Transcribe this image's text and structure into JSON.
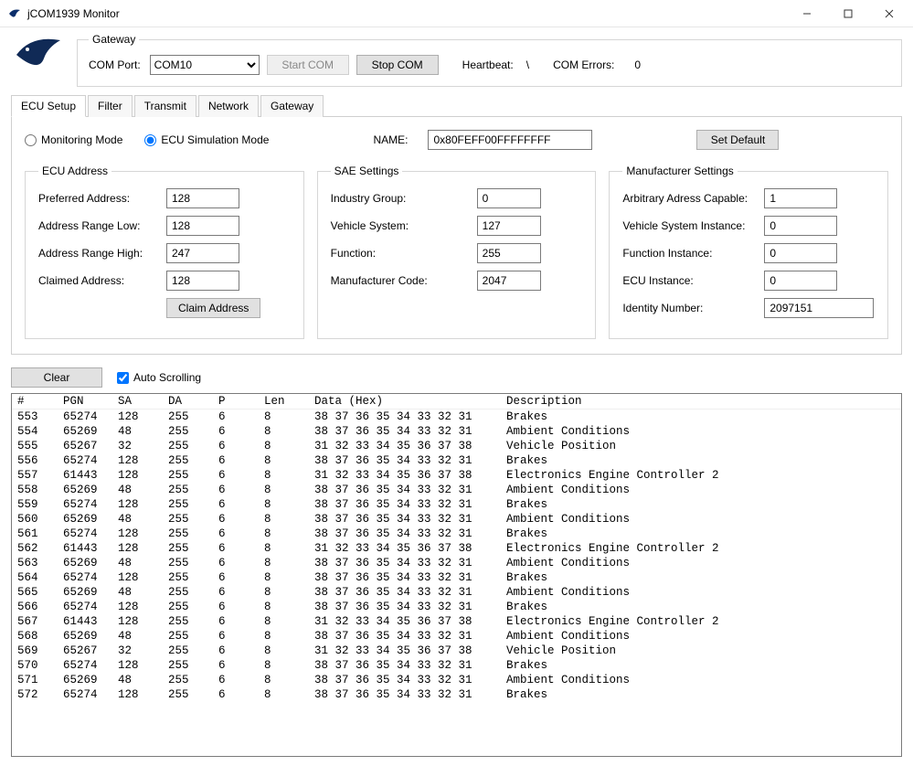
{
  "window": {
    "title": "jCOM1939 Monitor"
  },
  "gateway": {
    "legend": "Gateway",
    "comport_label": "COM Port:",
    "comport_value": "COM10",
    "start_label": "Start COM",
    "stop_label": "Stop COM",
    "heartbeat_label": "Heartbeat:",
    "heartbeat_value": "\\",
    "comerrors_label": "COM Errors:",
    "comerrors_value": "0"
  },
  "tabs": {
    "ecu": "ECU Setup",
    "filter": "Filter",
    "transmit": "Transmit",
    "network": "Network",
    "gateway": "Gateway"
  },
  "mode": {
    "monitoring": "Monitoring Mode",
    "simulation": "ECU Simulation Mode",
    "selected": "simulation"
  },
  "name": {
    "label": "NAME:",
    "value": "0x80FEFF00FFFFFFFF"
  },
  "set_default_label": "Set Default",
  "ecu_addr": {
    "legend": "ECU Address",
    "preferred_label": "Preferred Address:",
    "preferred": "128",
    "low_label": "Address Range Low:",
    "low": "128",
    "high_label": "Address Range High:",
    "high": "247",
    "claimed_label": "Claimed Address:",
    "claimed": "128",
    "claim_button": "Claim Address"
  },
  "sae": {
    "legend": "SAE Settings",
    "industry_label": "Industry Group:",
    "industry": "0",
    "vehsys_label": "Vehicle System:",
    "vehsys": "127",
    "function_label": "Function:",
    "function": "255",
    "mfgcode_label": "Manufacturer Code:",
    "mfgcode": "2047"
  },
  "mfg": {
    "legend": "Manufacturer Settings",
    "arb_label": "Arbitrary Adress Capable:",
    "arb": "1",
    "vsi_label": "Vehicle System Instance:",
    "vsi": "0",
    "fi_label": "Function Instance:",
    "fi": "0",
    "ecui_label": "ECU Instance:",
    "ecui": "0",
    "id_label": "Identity Number:",
    "id": "2097151"
  },
  "log": {
    "clear_label": "Clear",
    "autoscroll_label": "Auto Scrolling",
    "columns": {
      "num": "#",
      "pgn": "PGN",
      "sa": "SA",
      "da": "DA",
      "p": "P",
      "len": "Len",
      "data": "Data (Hex)",
      "desc": "Description"
    },
    "rows": [
      {
        "num": "553",
        "pgn": "65274",
        "sa": "128",
        "da": "255",
        "p": "6",
        "len": "8",
        "data": "38 37 36 35 34 33 32 31",
        "desc": "Brakes"
      },
      {
        "num": "554",
        "pgn": "65269",
        "sa": "48",
        "da": "255",
        "p": "6",
        "len": "8",
        "data": "38 37 36 35 34 33 32 31",
        "desc": "Ambient Conditions"
      },
      {
        "num": "555",
        "pgn": "65267",
        "sa": "32",
        "da": "255",
        "p": "6",
        "len": "8",
        "data": "31 32 33 34 35 36 37 38",
        "desc": "Vehicle Position"
      },
      {
        "num": "556",
        "pgn": "65274",
        "sa": "128",
        "da": "255",
        "p": "6",
        "len": "8",
        "data": "38 37 36 35 34 33 32 31",
        "desc": "Brakes"
      },
      {
        "num": "557",
        "pgn": "61443",
        "sa": "128",
        "da": "255",
        "p": "6",
        "len": "8",
        "data": "31 32 33 34 35 36 37 38",
        "desc": "Electronics Engine Controller 2"
      },
      {
        "num": "558",
        "pgn": "65269",
        "sa": "48",
        "da": "255",
        "p": "6",
        "len": "8",
        "data": "38 37 36 35 34 33 32 31",
        "desc": "Ambient Conditions"
      },
      {
        "num": "559",
        "pgn": "65274",
        "sa": "128",
        "da": "255",
        "p": "6",
        "len": "8",
        "data": "38 37 36 35 34 33 32 31",
        "desc": "Brakes"
      },
      {
        "num": "560",
        "pgn": "65269",
        "sa": "48",
        "da": "255",
        "p": "6",
        "len": "8",
        "data": "38 37 36 35 34 33 32 31",
        "desc": "Ambient Conditions"
      },
      {
        "num": "561",
        "pgn": "65274",
        "sa": "128",
        "da": "255",
        "p": "6",
        "len": "8",
        "data": "38 37 36 35 34 33 32 31",
        "desc": "Brakes"
      },
      {
        "num": "562",
        "pgn": "61443",
        "sa": "128",
        "da": "255",
        "p": "6",
        "len": "8",
        "data": "31 32 33 34 35 36 37 38",
        "desc": "Electronics Engine Controller 2"
      },
      {
        "num": "563",
        "pgn": "65269",
        "sa": "48",
        "da": "255",
        "p": "6",
        "len": "8",
        "data": "38 37 36 35 34 33 32 31",
        "desc": "Ambient Conditions"
      },
      {
        "num": "564",
        "pgn": "65274",
        "sa": "128",
        "da": "255",
        "p": "6",
        "len": "8",
        "data": "38 37 36 35 34 33 32 31",
        "desc": "Brakes"
      },
      {
        "num": "565",
        "pgn": "65269",
        "sa": "48",
        "da": "255",
        "p": "6",
        "len": "8",
        "data": "38 37 36 35 34 33 32 31",
        "desc": "Ambient Conditions"
      },
      {
        "num": "566",
        "pgn": "65274",
        "sa": "128",
        "da": "255",
        "p": "6",
        "len": "8",
        "data": "38 37 36 35 34 33 32 31",
        "desc": "Brakes"
      },
      {
        "num": "567",
        "pgn": "61443",
        "sa": "128",
        "da": "255",
        "p": "6",
        "len": "8",
        "data": "31 32 33 34 35 36 37 38",
        "desc": "Electronics Engine Controller 2"
      },
      {
        "num": "568",
        "pgn": "65269",
        "sa": "48",
        "da": "255",
        "p": "6",
        "len": "8",
        "data": "38 37 36 35 34 33 32 31",
        "desc": "Ambient Conditions"
      },
      {
        "num": "569",
        "pgn": "65267",
        "sa": "32",
        "da": "255",
        "p": "6",
        "len": "8",
        "data": "31 32 33 34 35 36 37 38",
        "desc": "Vehicle Position"
      },
      {
        "num": "570",
        "pgn": "65274",
        "sa": "128",
        "da": "255",
        "p": "6",
        "len": "8",
        "data": "38 37 36 35 34 33 32 31",
        "desc": "Brakes"
      },
      {
        "num": "571",
        "pgn": "65269",
        "sa": "48",
        "da": "255",
        "p": "6",
        "len": "8",
        "data": "38 37 36 35 34 33 32 31",
        "desc": "Ambient Conditions"
      },
      {
        "num": "572",
        "pgn": "65274",
        "sa": "128",
        "da": "255",
        "p": "6",
        "len": "8",
        "data": "38 37 36 35 34 33 32 31",
        "desc": "Brakes"
      }
    ]
  }
}
